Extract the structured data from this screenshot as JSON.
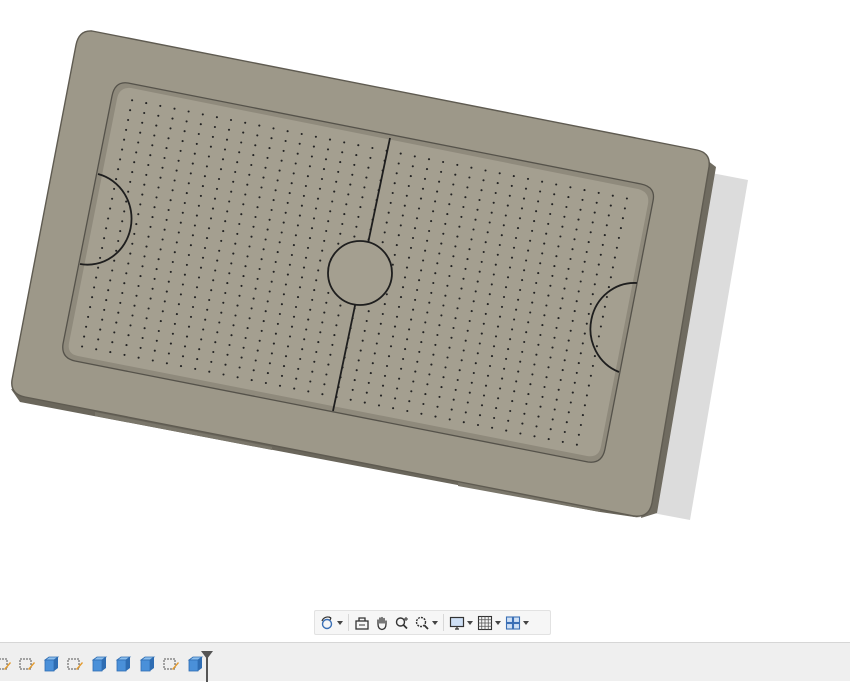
{
  "viewport": {
    "model_name": "air-hockey-table-board",
    "colors": {
      "body": "#9d9889",
      "body_edge": "#5f5b51",
      "body_side": "#6f6b60",
      "playfield": "#a49f90",
      "shadow": "#d4d4d4",
      "line": "#1e1e1e",
      "hole": "#222222"
    }
  },
  "nav_toolbar": {
    "buttons": [
      {
        "name": "orbit",
        "icon": "orbit-icon",
        "dropdown": true
      },
      {
        "name": "look-at",
        "icon": "look-at-icon",
        "dropdown": false
      },
      {
        "name": "pan",
        "icon": "pan-hand-icon",
        "dropdown": false
      },
      {
        "name": "zoom",
        "icon": "zoom-icon",
        "dropdown": false
      },
      {
        "name": "fit",
        "icon": "zoom-window-icon",
        "dropdown": true
      },
      {
        "name": "display-settings",
        "icon": "display-settings-icon",
        "dropdown": true
      },
      {
        "name": "grid-snaps",
        "icon": "grid-icon",
        "dropdown": true
      },
      {
        "name": "viewports",
        "icon": "viewports-icon",
        "dropdown": true
      }
    ]
  },
  "timeline": {
    "items": [
      {
        "type": "sketch",
        "icon": "sketch-feature-icon"
      },
      {
        "type": "sketch",
        "icon": "sketch-feature-icon"
      },
      {
        "type": "extrude",
        "icon": "extrude-feature-icon"
      },
      {
        "type": "sketch",
        "icon": "sketch-feature-icon"
      },
      {
        "type": "extrude",
        "icon": "extrude-feature-icon"
      },
      {
        "type": "extrude",
        "icon": "extrude-feature-icon"
      },
      {
        "type": "extrude",
        "icon": "extrude-feature-icon"
      },
      {
        "type": "sketch",
        "icon": "sketch-feature-icon"
      },
      {
        "type": "extrude",
        "icon": "extrude-feature-icon"
      }
    ],
    "marker_icon": "timeline-marker-icon"
  }
}
